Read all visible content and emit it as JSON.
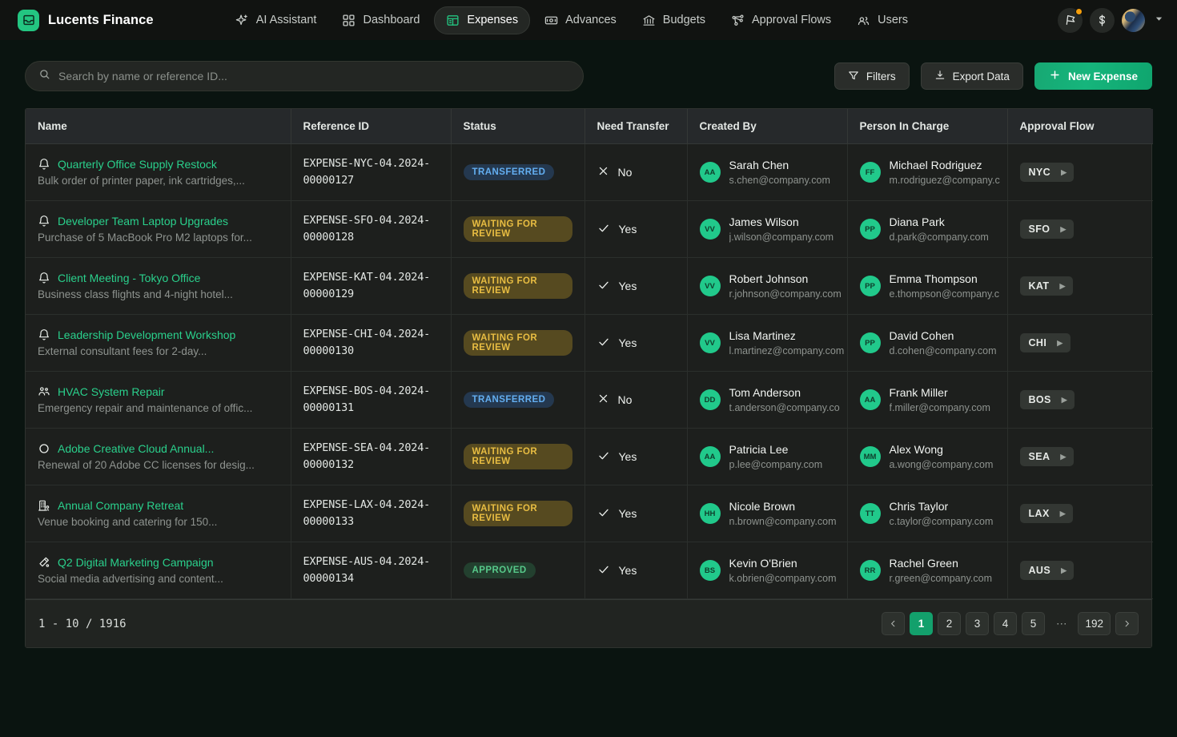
{
  "app": {
    "brand": "Lucents Finance",
    "logo_icon": "inbox-icon"
  },
  "nav": {
    "items": [
      {
        "label": "AI Assistant",
        "icon": "sparkles-icon",
        "active": false
      },
      {
        "label": "Dashboard",
        "icon": "grid-icon",
        "active": false
      },
      {
        "label": "Expenses",
        "icon": "receipt-icon",
        "active": true
      },
      {
        "label": "Advances",
        "icon": "banknote-icon",
        "active": false
      },
      {
        "label": "Budgets",
        "icon": "bank-icon",
        "active": false
      },
      {
        "label": "Approval Flows",
        "icon": "flow-nodes-icon",
        "active": false
      },
      {
        "label": "Users",
        "icon": "users-icon",
        "active": false
      }
    ],
    "right": {
      "flag_button_icon": "flag-icon",
      "has_notification_dot": true,
      "currency_button_icon": "dollar-icon",
      "avatar_icon": "user-avatar",
      "chevron_icon": "chevron-down-icon"
    }
  },
  "toolbar": {
    "search_placeholder": "Search by name or reference ID...",
    "search_value": "",
    "search_icon": "search-icon",
    "filters_label": "Filters",
    "filters_icon": "funnel-icon",
    "export_label": "Export Data",
    "export_icon": "download-icon",
    "new_expense_label": "New Expense",
    "new_expense_icon": "plus-icon"
  },
  "table": {
    "columns": [
      "Name",
      "Reference ID",
      "Status",
      "Need Transfer",
      "Created By",
      "Person In Charge",
      "Approval Flow"
    ],
    "rows": [
      {
        "icon": "bell-icon",
        "name": "Quarterly Office Supply Restock",
        "desc": "Bulk order of printer paper, ink cartridges,...",
        "ref": "EXPENSE-NYC-04.2024-00000127",
        "status": "TRANSFERRED",
        "status_kind": "transferred",
        "need_transfer": "No",
        "need_icon": "x-icon",
        "created_by": {
          "initials": "AA",
          "name": "Sarah Chen",
          "email": "s.chen@company.com"
        },
        "person_in_charge": {
          "initials": "FF",
          "name": "Michael Rodriguez",
          "email": "m.rodriguez@company.c"
        },
        "flow": "NYC"
      },
      {
        "icon": "bell-icon",
        "name": "Developer Team Laptop Upgrades",
        "desc": "Purchase of 5 MacBook Pro M2 laptops for...",
        "ref": "EXPENSE-SFO-04.2024-00000128",
        "status": "WAITING FOR REVIEW",
        "status_kind": "waiting",
        "need_transfer": "Yes",
        "need_icon": "check-icon",
        "created_by": {
          "initials": "VV",
          "name": "James Wilson",
          "email": "j.wilson@company.com"
        },
        "person_in_charge": {
          "initials": "PP",
          "name": "Diana Park",
          "email": "d.park@company.com"
        },
        "flow": "SFO"
      },
      {
        "icon": "bell-icon",
        "name": "Client Meeting - Tokyo Office",
        "desc": "Business class flights and 4-night hotel...",
        "ref": "EXPENSE-KAT-04.2024-00000129",
        "status": "WAITING FOR REVIEW",
        "status_kind": "waiting",
        "need_transfer": "Yes",
        "need_icon": "check-icon",
        "created_by": {
          "initials": "VV",
          "name": "Robert Johnson",
          "email": "r.johnson@company.com"
        },
        "person_in_charge": {
          "initials": "PP",
          "name": "Emma Thompson",
          "email": "e.thompson@company.c"
        },
        "flow": "KAT"
      },
      {
        "icon": "bell-icon",
        "name": "Leadership Development Workshop",
        "desc": "External consultant fees for 2-day...",
        "ref": "EXPENSE-CHI-04.2024-00000130",
        "status": "WAITING FOR REVIEW",
        "status_kind": "waiting",
        "need_transfer": "Yes",
        "need_icon": "check-icon",
        "created_by": {
          "initials": "VV",
          "name": "Lisa Martinez",
          "email": "l.martinez@company.com"
        },
        "person_in_charge": {
          "initials": "PP",
          "name": "David Cohen",
          "email": "d.cohen@company.com"
        },
        "flow": "CHI"
      },
      {
        "icon": "users-group-icon",
        "name": "HVAC System Repair",
        "desc": "Emergency repair and maintenance of offic...",
        "ref": "EXPENSE-BOS-04.2024-00000131",
        "status": "TRANSFERRED",
        "status_kind": "transferred",
        "need_transfer": "No",
        "need_icon": "x-icon",
        "created_by": {
          "initials": "DD",
          "name": "Tom Anderson",
          "email": "t.anderson@company.co"
        },
        "person_in_charge": {
          "initials": "AA",
          "name": "Frank Miller",
          "email": "f.miller@company.com"
        },
        "flow": "BOS"
      },
      {
        "icon": "circle-icon",
        "name": "Adobe Creative Cloud Annual...",
        "desc": "Renewal of 20 Adobe CC licenses for desig...",
        "ref": "EXPENSE-SEA-04.2024-00000132",
        "status": "WAITING FOR REVIEW",
        "status_kind": "waiting",
        "need_transfer": "Yes",
        "need_icon": "check-icon",
        "created_by": {
          "initials": "AA",
          "name": "Patricia Lee",
          "email": "p.lee@company.com"
        },
        "person_in_charge": {
          "initials": "MM",
          "name": "Alex Wong",
          "email": "a.wong@company.com"
        },
        "flow": "SEA"
      },
      {
        "icon": "building-icon",
        "name": "Annual Company Retreat",
        "desc": "Venue booking and catering for 150...",
        "ref": "EXPENSE-LAX-04.2024-00000133",
        "status": "WAITING FOR REVIEW",
        "status_kind": "waiting",
        "need_transfer": "Yes",
        "need_icon": "check-icon",
        "created_by": {
          "initials": "HH",
          "name": "Nicole Brown",
          "email": "n.brown@company.com"
        },
        "person_in_charge": {
          "initials": "TT",
          "name": "Chris Taylor",
          "email": "c.taylor@company.com"
        },
        "flow": "LAX"
      },
      {
        "icon": "flask-icon",
        "name": "Q2 Digital Marketing Campaign",
        "desc": "Social media advertising and content...",
        "ref": "EXPENSE-AUS-04.2024-00000134",
        "status": "APPROVED",
        "status_kind": "approved",
        "need_transfer": "Yes",
        "need_icon": "check-icon",
        "created_by": {
          "initials": "BS",
          "name": "Kevin O'Brien",
          "email": "k.obrien@company.com"
        },
        "person_in_charge": {
          "initials": "RR",
          "name": "Rachel Green",
          "email": "r.green@company.com"
        },
        "flow": "AUS"
      }
    ]
  },
  "pagination": {
    "count_label": "1 - 10 / 1916",
    "prev_icon": "chevron-left-icon",
    "next_icon": "chevron-right-icon",
    "pages": [
      "1",
      "2",
      "3",
      "4",
      "5",
      "⋯",
      "192"
    ],
    "active_page": "1"
  },
  "colors": {
    "accent": "#23c581",
    "link": "#2ad08c",
    "page_bg": "#0a1410",
    "nav_bg": "#111311",
    "card_bg": "#1d1f1d",
    "badge_transferred": "#63aef0",
    "badge_waiting": "#e8bd42",
    "badge_approved": "#57c98a",
    "notification_dot": "#f59e0b"
  }
}
